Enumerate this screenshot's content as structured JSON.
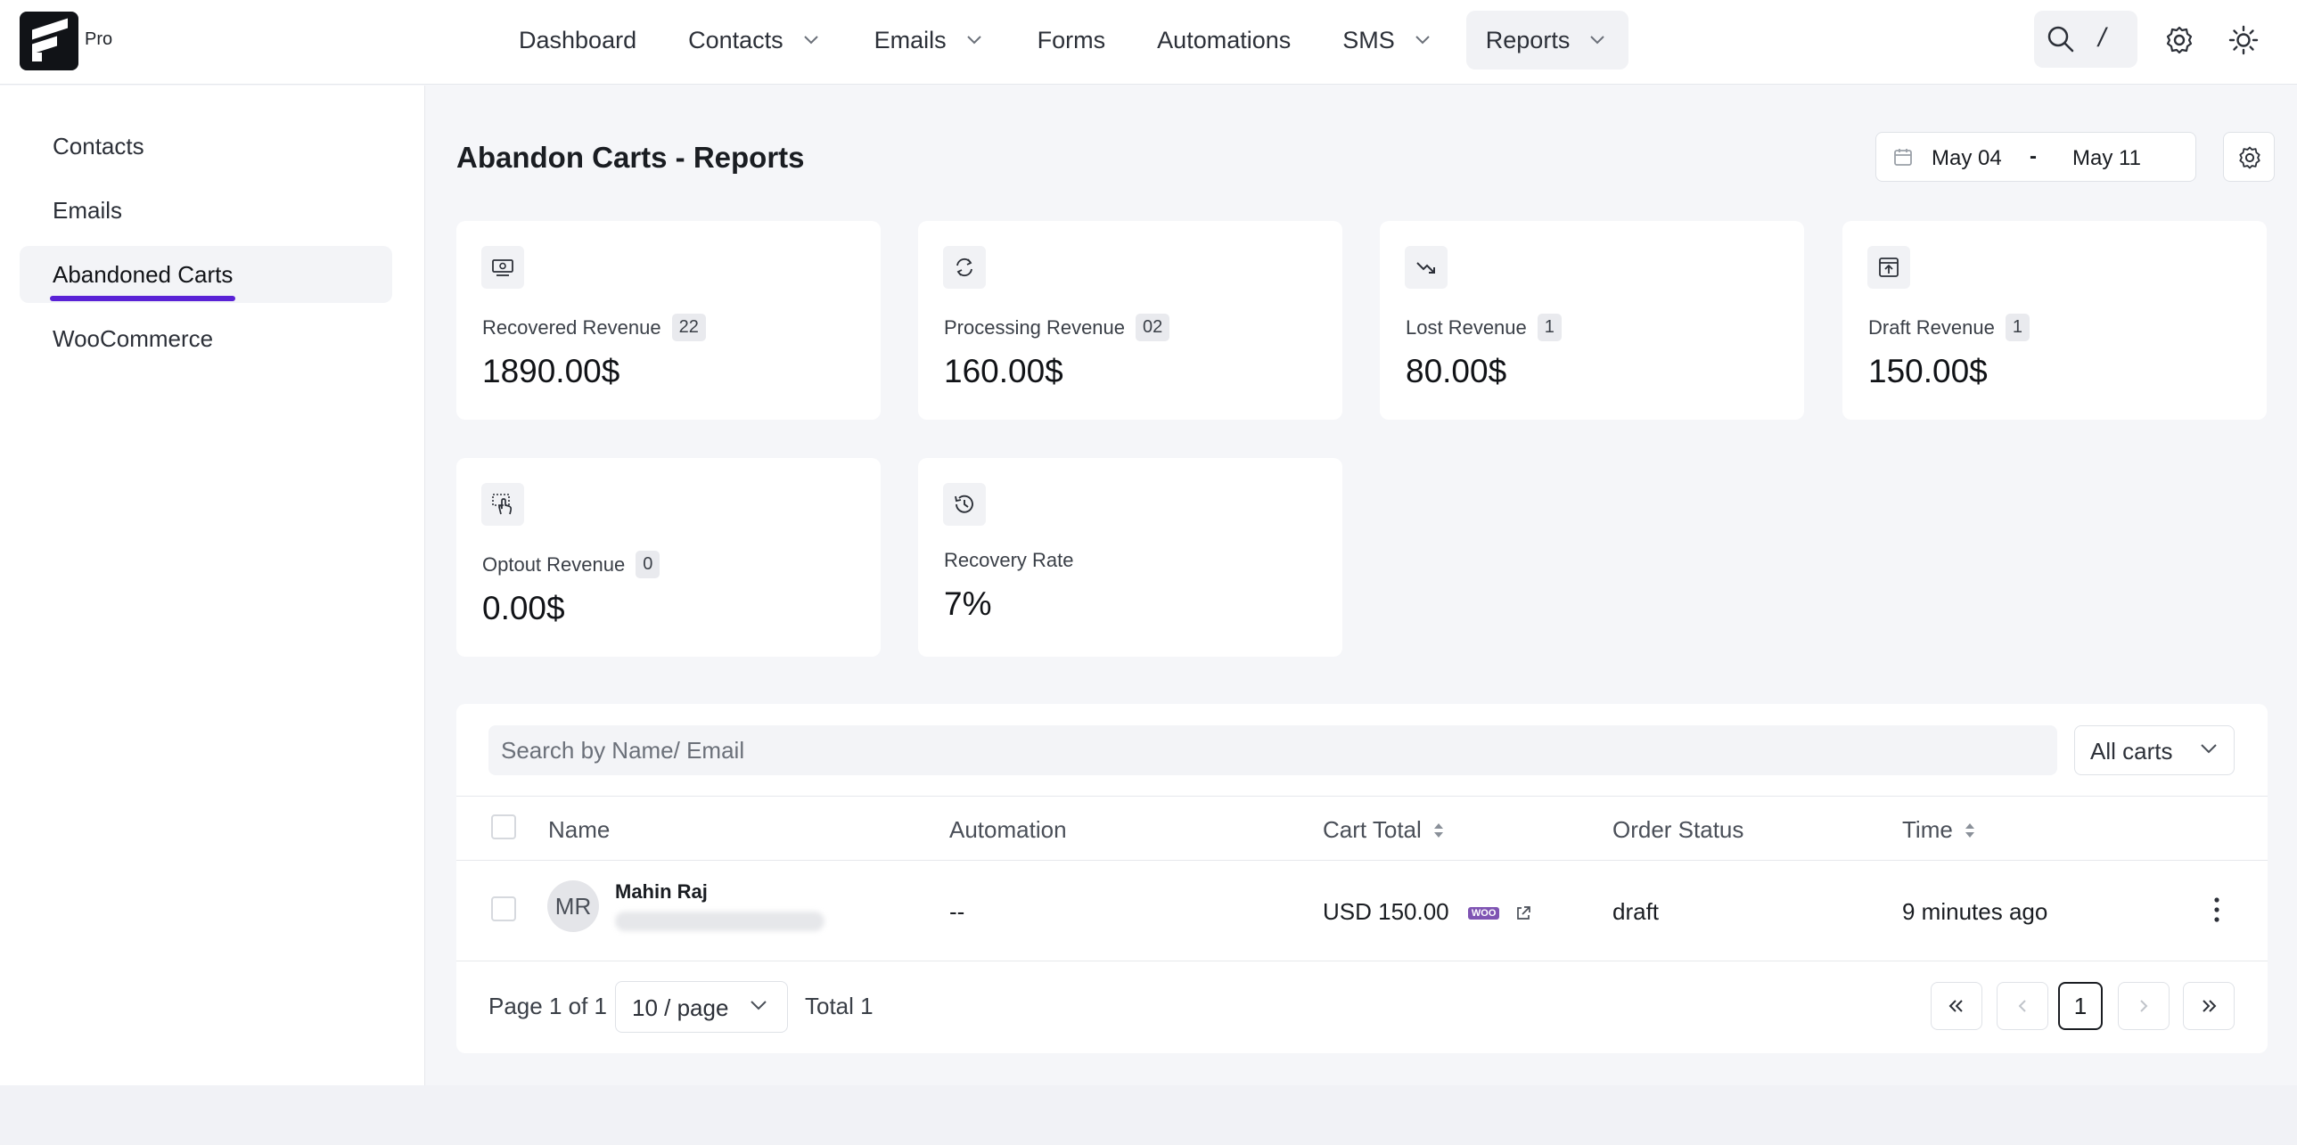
{
  "brand": {
    "badge": "Pro"
  },
  "nav": [
    {
      "label": "Dashboard",
      "dropdown": false
    },
    {
      "label": "Contacts",
      "dropdown": true
    },
    {
      "label": "Emails",
      "dropdown": true
    },
    {
      "label": "Forms",
      "dropdown": false
    },
    {
      "label": "Automations",
      "dropdown": false
    },
    {
      "label": "SMS",
      "dropdown": true
    },
    {
      "label": "Reports",
      "dropdown": true,
      "active": true
    }
  ],
  "header_actions": {
    "search_shortcut": "/"
  },
  "sidebar": {
    "items": [
      {
        "label": "Contacts"
      },
      {
        "label": "Emails"
      },
      {
        "label": "Abandoned Carts",
        "active": true
      },
      {
        "label": "WooCommerce"
      }
    ],
    "accent_color": "#5a22d6"
  },
  "page": {
    "title": "Abandon Carts - Reports",
    "date_range": {
      "start": "May 04",
      "separator": "-",
      "end": "May 11"
    }
  },
  "stats": [
    {
      "icon": "money-refund-icon",
      "label": "Recovered Revenue",
      "badge": "22",
      "value": "1890.00$"
    },
    {
      "icon": "processing-cycle-icon",
      "label": "Processing Revenue",
      "badge": "02",
      "value": "160.00$"
    },
    {
      "icon": "trend-down-icon",
      "label": "Lost Revenue",
      "badge": "1",
      "value": "80.00$"
    },
    {
      "icon": "draft-upload-icon",
      "label": "Draft Revenue",
      "badge": "1",
      "value": "150.00$"
    },
    {
      "icon": "optout-hand-icon",
      "label": "Optout Revenue",
      "badge": "0",
      "value": "0.00$"
    },
    {
      "icon": "history-icon",
      "label": "Recovery Rate",
      "badge": "",
      "value": "7%"
    }
  ],
  "table": {
    "search_placeholder": "Search by Name/ Email",
    "filter": "All carts",
    "columns": [
      "Name",
      "Automation",
      "Cart Total",
      "Order Status",
      "Time"
    ],
    "rows": [
      {
        "initials": "MR",
        "name": "Mahin Raj",
        "automation": "--",
        "cart_total": "USD 150.00",
        "woo_badge": "WOO",
        "order_status": "draft",
        "time": "9 minutes ago"
      }
    ]
  },
  "pagination": {
    "page_info": "Page 1 of 1",
    "per_page": "10 / page",
    "total": "Total 1",
    "current_page": "1"
  }
}
